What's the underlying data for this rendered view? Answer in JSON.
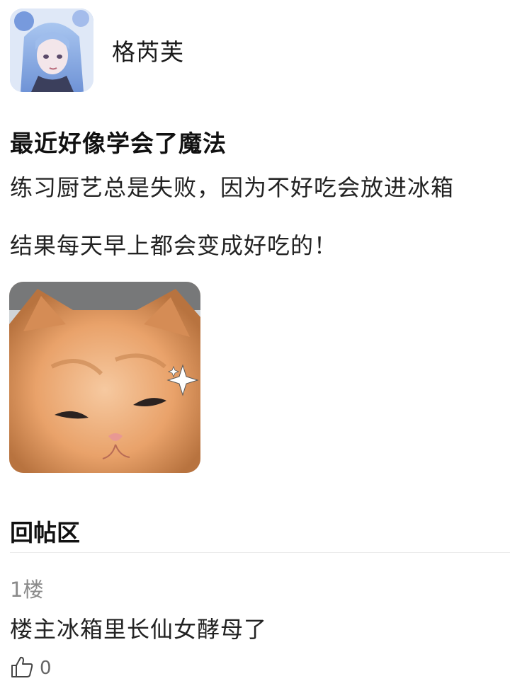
{
  "author": {
    "name": "格芮芙",
    "avatar": "avatar-anime-character"
  },
  "post": {
    "title": "最近好像学会了魔法",
    "line1": "练习厨艺总是失败，因为不好吃会放进冰箱",
    "line2": "结果每天早上都会变成好吃的！",
    "image": "orange-kitten-photo"
  },
  "replies_section": {
    "title": "回帖区",
    "items": [
      {
        "floor": "1楼",
        "text": "楼主冰箱里长仙女酵母了",
        "like_icon": "thumbs-up-icon",
        "like_count": "0"
      }
    ]
  },
  "colors": {
    "text_primary": "#111111",
    "text_secondary": "#8a8a8a",
    "divider": "#ececec"
  }
}
